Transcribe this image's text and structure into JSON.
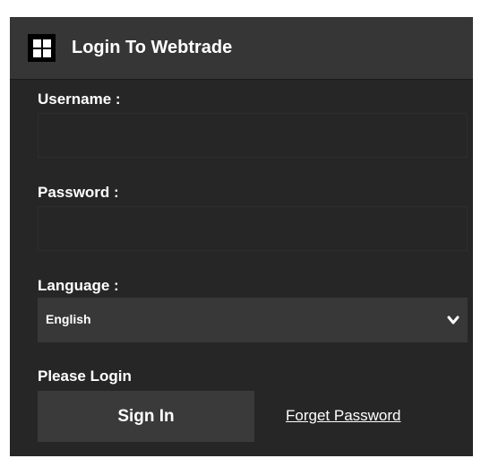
{
  "header": {
    "icon": "grid-icon",
    "title": "Login To Webtrade"
  },
  "form": {
    "username": {
      "label": "Username :",
      "value": ""
    },
    "password": {
      "label": "Password :",
      "value": ""
    },
    "language": {
      "label": "Language :",
      "selected": "English",
      "icon": "chevron-down-icon"
    }
  },
  "status": {
    "message": "Please Login"
  },
  "actions": {
    "signin_label": "Sign In",
    "forget_label": "Forget Password"
  },
  "colors": {
    "panel_bg": "#262626",
    "header_bg": "#363636",
    "button_bg": "#3a3a3a",
    "select_bg": "#383838",
    "text": "#ffffff"
  }
}
